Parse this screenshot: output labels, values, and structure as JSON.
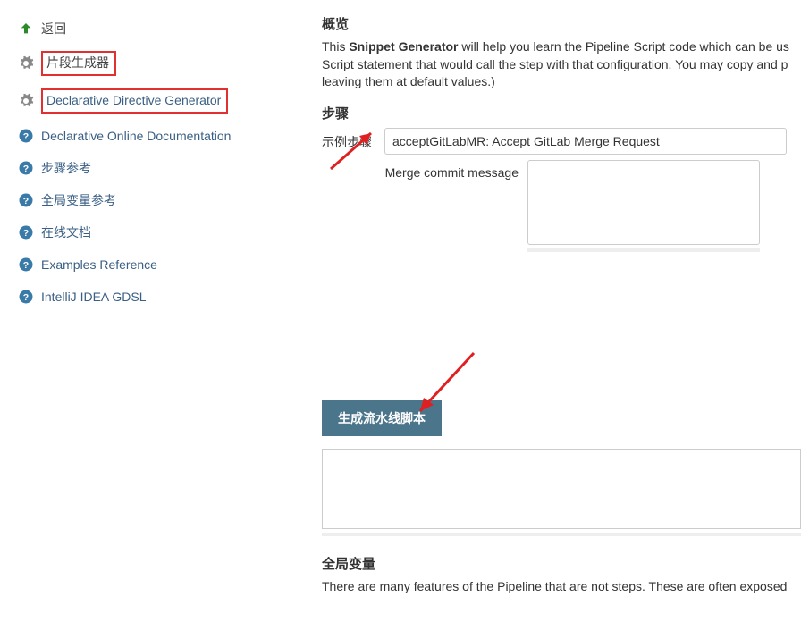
{
  "sidebar": {
    "back": "返回",
    "items": [
      {
        "label": "片段生成器",
        "highlighted": true
      },
      {
        "label": "Declarative Directive Generator",
        "highlighted": true
      },
      {
        "label": "Declarative Online Documentation"
      },
      {
        "label": "步骤参考"
      },
      {
        "label": "全局变量参考"
      },
      {
        "label": "在线文档"
      },
      {
        "label": "Examples Reference"
      },
      {
        "label": "IntelliJ IDEA GDSL"
      }
    ]
  },
  "main": {
    "overview_title": "概览",
    "desc_prefix": "This ",
    "desc_strong": "Snippet Generator",
    "desc_rest": " will help you learn the Pipeline Script code which can be us Script statement that would call the step with that configuration. You may copy and p leaving them at default values.)",
    "steps_title": "步骤",
    "sample_step_label": "示例步骤",
    "sample_step_value": "acceptGitLabMR: Accept GitLab Merge Request",
    "merge_commit_label": "Merge commit message",
    "generate_button": "生成流水线脚本",
    "globals_title": "全局变量",
    "globals_desc": "There are many features of the Pipeline that are not steps. These are often exposed"
  }
}
